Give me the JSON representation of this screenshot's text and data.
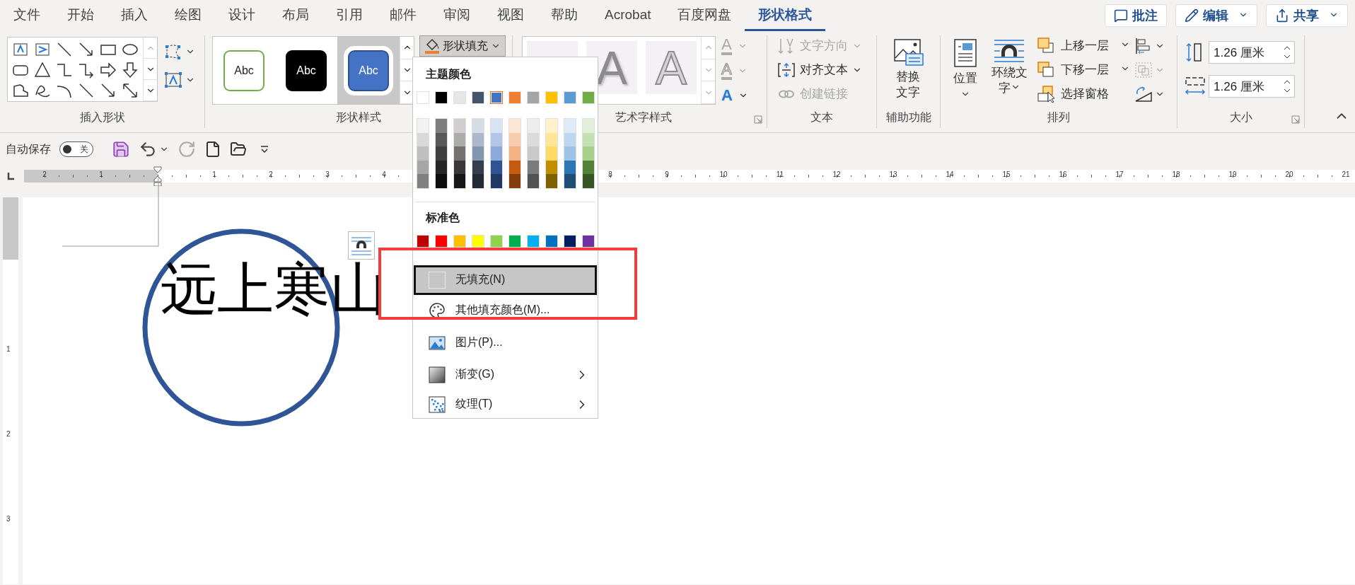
{
  "tabs": [
    {
      "label": "文件",
      "selected": false
    },
    {
      "label": "开始",
      "selected": false
    },
    {
      "label": "插入",
      "selected": false
    },
    {
      "label": "绘图",
      "selected": false
    },
    {
      "label": "设计",
      "selected": false
    },
    {
      "label": "布局",
      "selected": false
    },
    {
      "label": "引用",
      "selected": false
    },
    {
      "label": "邮件",
      "selected": false
    },
    {
      "label": "审阅",
      "selected": false
    },
    {
      "label": "视图",
      "selected": false
    },
    {
      "label": "帮助",
      "selected": false
    },
    {
      "label": "Acrobat",
      "selected": false
    },
    {
      "label": "百度网盘",
      "selected": false
    },
    {
      "label": "形状格式",
      "selected": true
    }
  ],
  "header_buttons": [
    {
      "kind": "comment",
      "label": "批注",
      "has_menu": false
    },
    {
      "kind": "edit",
      "label": "编辑",
      "has_menu": true
    },
    {
      "kind": "share",
      "label": "共享",
      "has_menu": true
    }
  ],
  "ribbon": {
    "insert_shapes": {
      "label": "插入形状"
    },
    "shape_styles": {
      "label": "形状样式",
      "presets": [
        {
          "kind": "outline",
          "label": "Abc",
          "selected": false
        },
        {
          "kind": "dark",
          "label": "Abc",
          "selected": false
        },
        {
          "kind": "accent",
          "label": "Abc",
          "selected": true
        }
      ],
      "fill_button": {
        "label": "形状填充",
        "expanded": true
      }
    },
    "wordart_styles": {
      "label": "艺术字样式",
      "presets": [
        {
          "kind": "shadow",
          "label": "A"
        },
        {
          "kind": "outline",
          "label": "A"
        }
      ],
      "tools": [
        {
          "kind": "fill",
          "glyph": "A",
          "disabled": true
        },
        {
          "kind": "outline",
          "glyph": "A",
          "disabled": true
        },
        {
          "kind": "effects",
          "glyph": "A",
          "disabled": false
        }
      ]
    },
    "text": {
      "label": "文本",
      "commands": [
        {
          "kind": "direction",
          "label": "文字方向",
          "disabled": true
        },
        {
          "kind": "align",
          "label": "对齐文本",
          "disabled": false
        },
        {
          "kind": "link",
          "label": "创建链接",
          "disabled": true
        }
      ]
    },
    "accessibility": {
      "label": "辅助功能",
      "button": "替换文字"
    },
    "arrange": {
      "label": "排列",
      "position": "位置",
      "wrap": "环绕文字",
      "commands": [
        {
          "kind": "forward",
          "label": "上移一层",
          "has_menu": true
        },
        {
          "kind": "backward",
          "label": "下移一层",
          "has_menu": true
        },
        {
          "kind": "pane",
          "label": "选择窗格",
          "has_menu": false
        }
      ]
    },
    "size": {
      "label": "大小",
      "fields": [
        {
          "kind": "height",
          "value": "1.26 厘米"
        },
        {
          "kind": "width",
          "value": "1.26 厘米"
        }
      ]
    }
  },
  "quick_access": {
    "autosave_label": "自动保存",
    "autosave_on": false,
    "autosave_state": "关"
  },
  "horizontal_ruler": {
    "left_labels": [
      "2",
      "1"
    ],
    "right_labels": [
      "1",
      "2",
      "3",
      "4",
      "8",
      "9",
      "10",
      "11",
      "12",
      "13",
      "14",
      "15",
      "16",
      "17",
      "18",
      "19",
      "20",
      "21"
    ]
  },
  "vertical_ruler": {
    "labels": [
      "1",
      "2",
      "3"
    ]
  },
  "fill_menu": {
    "theme_title": "主题颜色",
    "theme_colors": [
      {
        "color": "#ffffff",
        "selected": false
      },
      {
        "color": "#000000",
        "selected": false
      },
      {
        "color": "#e7e6e6",
        "selected": false
      },
      {
        "color": "#44546a",
        "selected": false
      },
      {
        "color": "#4472c4",
        "selected": true
      },
      {
        "color": "#ed7d31",
        "selected": false
      },
      {
        "color": "#a5a5a5",
        "selected": false
      },
      {
        "color": "#ffc000",
        "selected": false
      },
      {
        "color": "#5b9bd5",
        "selected": false
      },
      {
        "color": "#70ad47",
        "selected": false
      }
    ],
    "shade_columns": [
      {
        "shades": [
          {
            "color": "#f2f2f2"
          },
          {
            "color": "#d9d9d9"
          },
          {
            "color": "#bfbfbf"
          },
          {
            "color": "#a6a6a6"
          },
          {
            "color": "#808080"
          }
        ]
      },
      {
        "shades": [
          {
            "color": "#7f7f7f"
          },
          {
            "color": "#595959"
          },
          {
            "color": "#404040"
          },
          {
            "color": "#262626"
          },
          {
            "color": "#0d0d0d"
          }
        ]
      },
      {
        "shades": [
          {
            "color": "#d0cece"
          },
          {
            "color": "#aeabab"
          },
          {
            "color": "#757171"
          },
          {
            "color": "#3a3838"
          },
          {
            "color": "#171717"
          }
        ]
      },
      {
        "shades": [
          {
            "color": "#d6dce4"
          },
          {
            "color": "#adb9ca"
          },
          {
            "color": "#8497b0"
          },
          {
            "color": "#333f4f"
          },
          {
            "color": "#222a35"
          }
        ]
      },
      {
        "shades": [
          {
            "color": "#d9e2f3"
          },
          {
            "color": "#b4c6e7"
          },
          {
            "color": "#8eaadb"
          },
          {
            "color": "#2f5496"
          },
          {
            "color": "#1f3864"
          }
        ]
      },
      {
        "shades": [
          {
            "color": "#fbe5d5"
          },
          {
            "color": "#f7cbac"
          },
          {
            "color": "#f4b183"
          },
          {
            "color": "#c55a11"
          },
          {
            "color": "#843c0b"
          }
        ]
      },
      {
        "shades": [
          {
            "color": "#ededed"
          },
          {
            "color": "#dbdbdb"
          },
          {
            "color": "#c9c9c9"
          },
          {
            "color": "#7b7b7b"
          },
          {
            "color": "#525252"
          }
        ]
      },
      {
        "shades": [
          {
            "color": "#fff2cc"
          },
          {
            "color": "#ffe599"
          },
          {
            "color": "#ffd966"
          },
          {
            "color": "#bf8f00"
          },
          {
            "color": "#7f6000"
          }
        ]
      },
      {
        "shades": [
          {
            "color": "#deebf6"
          },
          {
            "color": "#bdd7ee"
          },
          {
            "color": "#9dc3e6"
          },
          {
            "color": "#2e75b5"
          },
          {
            "color": "#1f4e79"
          }
        ]
      },
      {
        "shades": [
          {
            "color": "#e2efd9"
          },
          {
            "color": "#c5e0b3"
          },
          {
            "color": "#a8d08d"
          },
          {
            "color": "#538135"
          },
          {
            "color": "#375623"
          }
        ]
      }
    ],
    "standard_title": "标准色",
    "standard_colors": [
      {
        "color": "#c00000"
      },
      {
        "color": "#ff0000"
      },
      {
        "color": "#ffc000"
      },
      {
        "color": "#ffff00"
      },
      {
        "color": "#92d050"
      },
      {
        "color": "#00b050"
      },
      {
        "color": "#00b0f0"
      },
      {
        "color": "#0070c0"
      },
      {
        "color": "#002060"
      },
      {
        "color": "#7030a0"
      }
    ],
    "items": [
      {
        "kind": "no_fill",
        "label": "无填充(N)",
        "selected": true,
        "submenu": false
      },
      {
        "kind": "more_colors",
        "label": "其他填充颜色(M)...",
        "selected": false,
        "submenu": false
      },
      {
        "kind": "picture",
        "label": "图片(P)...",
        "selected": false,
        "submenu": false
      },
      {
        "kind": "gradient",
        "label": "渐变(G)",
        "selected": false,
        "submenu": true
      },
      {
        "kind": "texture",
        "label": "纹理(T)",
        "selected": false,
        "submenu": true
      }
    ]
  },
  "document": {
    "text": "远上寒山"
  }
}
